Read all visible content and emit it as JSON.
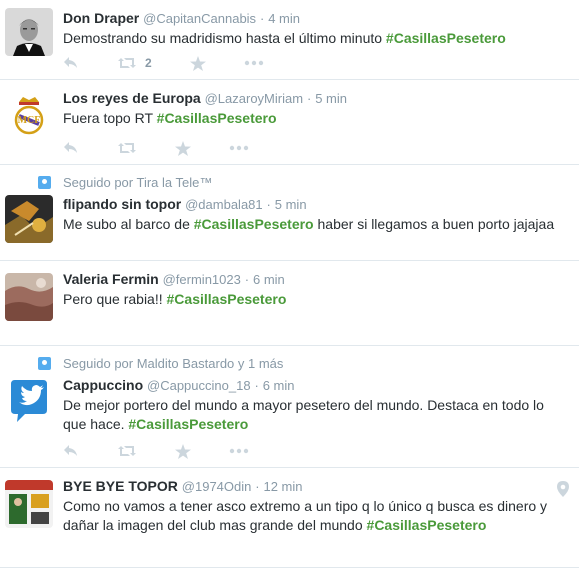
{
  "colors": {
    "hashtag": "#4a9a3a",
    "meta": "#8899a6",
    "action": "#ccd6dd",
    "divider": "#e1e8ed"
  },
  "tweets": [
    {
      "fullname": "Don Draper",
      "username": "@CapitanCannabis",
      "time": "4 min",
      "text": "Demostrando su madridismo hasta el último minuto",
      "hashtag": "#CasillasPesetero",
      "retweet_count": "2",
      "avatar_icon": "man-portrait-avatar"
    },
    {
      "fullname": "Los reyes de Europa",
      "username": "@LazaroyMiriam",
      "time": "5 min",
      "text": "Fuera topo RT",
      "hashtag": "#CasillasPesetero",
      "avatar_icon": "real-madrid-crest-avatar"
    },
    {
      "social": "Seguido por Tira la Tele™",
      "fullname": "flipando sin topor",
      "username": "@dambala81",
      "time": "5 min",
      "text_before": "Me subo al barco de",
      "hashtag": "#CasillasPesetero",
      "text_after": "haber si llegamos a buen porto jajajaa",
      "avatar_icon": "artwork-avatar"
    },
    {
      "fullname": "Valeria Fermin",
      "username": "@fermin1023",
      "time": "6 min",
      "text": "Pero que rabia!!",
      "hashtag": "#CasillasPesetero",
      "avatar_icon": "landscape-avatar"
    },
    {
      "social": "Seguido por Maldito Bastardo y 1 más",
      "fullname": "Cappuccino",
      "username": "@Cappuccino_18",
      "time": "6 min",
      "text": "De mejor portero del mundo a mayor pesetero del mundo. Destaca en todo lo que hace.",
      "hashtag": "#CasillasPesetero",
      "avatar_icon": "twitter-bird-avatar"
    },
    {
      "fullname": "BYE BYE TOPOR",
      "username": "@1974Odin",
      "time": "12 min",
      "text": "Como no vamos a tener asco extremo a un tipo q lo único q busca es dinero y dañar la imagen del club mas grande del mundo",
      "hashtag": "#CasillasPesetero",
      "avatar_icon": "magazine-cover-avatar"
    }
  ]
}
